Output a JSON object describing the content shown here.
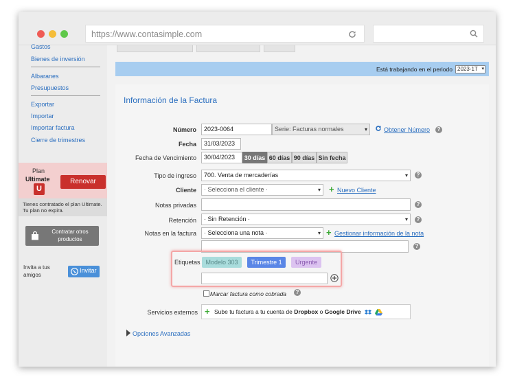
{
  "browser": {
    "url": "https://www.contasimple.com"
  },
  "sidebar": {
    "partial_top": "Gastos",
    "items": [
      {
        "label": "Bienes de inversión"
      },
      {
        "label": "Albaranes"
      },
      {
        "label": "Presupuestos"
      },
      {
        "label": "Exportar"
      },
      {
        "label": "Importar"
      },
      {
        "label": "Importar factura"
      },
      {
        "label": "Cierre de trimestres"
      }
    ],
    "plan": {
      "plan_word": "Plan",
      "plan_name": "Ultimate",
      "badge": "U",
      "renew_label": "Renovar",
      "note": "Tienes contratado el plan Ultimate. Tu plan no expira."
    },
    "contract_label": "Contratar otros productos",
    "invite_text": "Invita a tus amigos",
    "invite_button": "Invitar"
  },
  "header": {
    "period_text": "Está trabajando en el periodo",
    "period_value": "2023-1T"
  },
  "form": {
    "title": "Información de la Factura",
    "numero_label": "Número",
    "numero_value": "2023-0064",
    "serie_value": "Serie: Facturas normales",
    "obtener_link": "Obtener Número",
    "fecha_label": "Fecha",
    "fecha_value": "31/03/2023",
    "venc_label": "Fecha de Vencimiento",
    "venc_value": "30/04/2023",
    "venc_options": [
      "30 días",
      "60 días",
      "90 días",
      "Sin fecha"
    ],
    "venc_selected": "30 días",
    "tipo_label": "Tipo de ingreso",
    "tipo_value": "700. Venta de mercaderías",
    "cliente_label": "Cliente",
    "cliente_value": "· Selecciona el cliente ·",
    "nuevo_cliente": "Nuevo Cliente",
    "notas_privadas_label": "Notas privadas",
    "retencion_label": "Retención",
    "retencion_value": "· Sin Retención ·",
    "notas_factura_label": "Notas en la factura",
    "notas_factura_value": "· Selecciona una nota ·",
    "gestionar_link": "Gestionar información de la nota",
    "etiquetas_label": "Etiquetas",
    "tags": [
      {
        "label": "Modelo 303",
        "bg": "#a9dcdc",
        "fg": "#5a8a8a"
      },
      {
        "label": "Trimestre 1",
        "bg": "#5a86e6",
        "fg": "#ffffff"
      },
      {
        "label": "Urgente",
        "bg": "#dcc3f0",
        "fg": "#8a5ab0"
      }
    ],
    "marcar_label": "Marcar factura como cobrada",
    "servicios_label": "Servicios externos",
    "servicios_text_a": "Sube tu factura a tu cuenta de",
    "servicios_dropbox": "Dropbox",
    "servicios_o": "o",
    "servicios_gdrive": "Google Drive",
    "opciones_avanzadas": "Opciones Avanzadas"
  },
  "colors": {
    "accent_blue": "#2a6ebf",
    "renew_red": "#c9302c",
    "highlight_red": "#f08080"
  }
}
